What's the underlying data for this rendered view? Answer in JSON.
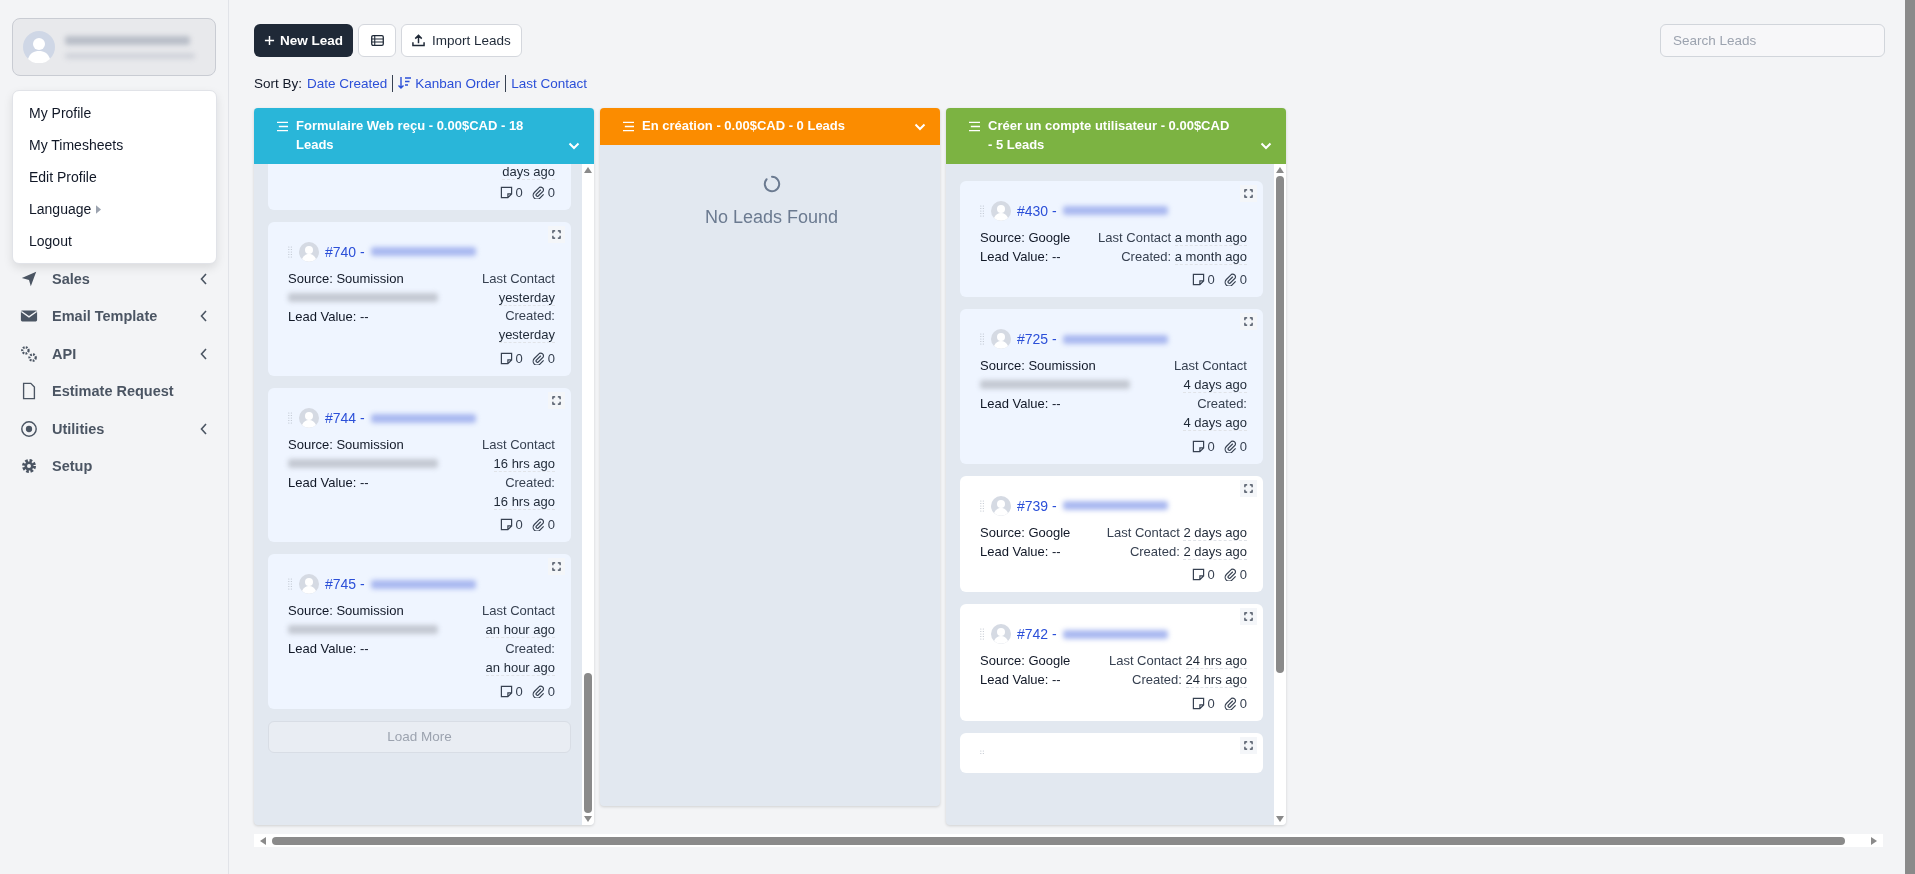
{
  "sidebar": {
    "profile_menu": [
      {
        "label": "My Profile",
        "submenu": false
      },
      {
        "label": "My Timesheets",
        "submenu": false
      },
      {
        "label": "Edit Profile",
        "submenu": false
      },
      {
        "label": "Language",
        "submenu": true
      },
      {
        "label": "Logout",
        "submenu": false
      }
    ],
    "nav": [
      {
        "label": "Sales",
        "submenu": true
      },
      {
        "label": "Email Template",
        "submenu": true
      },
      {
        "label": "API",
        "submenu": true
      },
      {
        "label": "Estimate Request",
        "submenu": false
      },
      {
        "label": "Utilities",
        "submenu": true
      },
      {
        "label": "Setup",
        "submenu": false
      }
    ]
  },
  "toolbar": {
    "new_lead": "New Lead",
    "import": "Import Leads",
    "search": {
      "placeholder": "Search Leads"
    }
  },
  "sort": {
    "label": "Sort By:",
    "options": [
      {
        "label": "Date Created",
        "selected": false
      },
      {
        "label": "Kanban Order",
        "selected": true
      },
      {
        "label": "Last Contact",
        "selected": false
      }
    ]
  },
  "columns": [
    {
      "title": "Formulaire Web reçu - 0.00$CAD - 18 Leads",
      "color": "#29b6d9",
      "load_more": "Load More",
      "cards": [
        {
          "kind": "clipped",
          "highlighted": true,
          "tail": "days ago",
          "notes": "0",
          "attachments": "0"
        },
        {
          "kind": "lead",
          "highlighted": true,
          "ref": "#740 -",
          "source": "Source: Soumission",
          "blurred_email": true,
          "value": "Lead Value: --",
          "last_contact_label": "Last Contact",
          "last_contact": "yesterday",
          "created_label": "Created:",
          "created": "yesterday",
          "notes": "0",
          "attachments": "0"
        },
        {
          "kind": "lead",
          "highlighted": true,
          "ref": "#744 -",
          "source": "Source: Soumission",
          "blurred_email": true,
          "value": "Lead Value: --",
          "last_contact_label": "Last Contact",
          "last_contact": "16 hrs ago",
          "created_label": "Created:",
          "created": "16 hrs ago",
          "notes": "0",
          "attachments": "0"
        },
        {
          "kind": "lead",
          "highlighted": true,
          "ref": "#745 -",
          "source": "Source: Soumission",
          "blurred_email": true,
          "value": "Lead Value: --",
          "last_contact_label": "Last Contact",
          "last_contact": "an hour ago",
          "created_label": "Created:",
          "created": "an hour ago",
          "notes": "0",
          "attachments": "0"
        }
      ]
    },
    {
      "title": "En création - 0.00$CAD - 0 Leads",
      "color": "#fb8c00",
      "empty_text": "No Leads Found"
    },
    {
      "title": "Créer un compte utilisateur - 0.00$CAD - 5 Leads",
      "color": "#7cb342",
      "cards": [
        {
          "kind": "lead",
          "highlighted": true,
          "ref": "#430 -",
          "source": "Source: Google",
          "blurred_email": false,
          "value": "Lead Value: --",
          "last_contact_label": "Last Contact",
          "last_contact": "a month ago",
          "created_label": "Created:",
          "created": "a month ago",
          "notes": "0",
          "attachments": "0"
        },
        {
          "kind": "lead",
          "highlighted": true,
          "ref": "#725 -",
          "source": "Source: Soumission",
          "blurred_email": true,
          "value": "Lead Value: --",
          "last_contact_label": "Last Contact",
          "last_contact": "4 days ago",
          "created_label": "Created:",
          "created": "4 days ago",
          "notes": "0",
          "attachments": "0"
        },
        {
          "kind": "lead",
          "highlighted": false,
          "ref": "#739 -",
          "source": "Source: Google",
          "blurred_email": false,
          "value": "Lead Value: --",
          "last_contact_label": "Last Contact",
          "last_contact": "2 days ago",
          "created_label": "Created:",
          "created": "2 days ago",
          "notes": "0",
          "attachments": "0"
        },
        {
          "kind": "lead",
          "highlighted": false,
          "ref": "#742 -",
          "source": "Source: Google",
          "blurred_email": false,
          "value": "Lead Value: --",
          "last_contact_label": "Last Contact",
          "last_contact": "24 hrs ago",
          "created_label": "Created:",
          "created": "24 hrs ago",
          "notes": "0",
          "attachments": "0"
        },
        {
          "kind": "stub",
          "highlighted": false
        }
      ]
    }
  ]
}
